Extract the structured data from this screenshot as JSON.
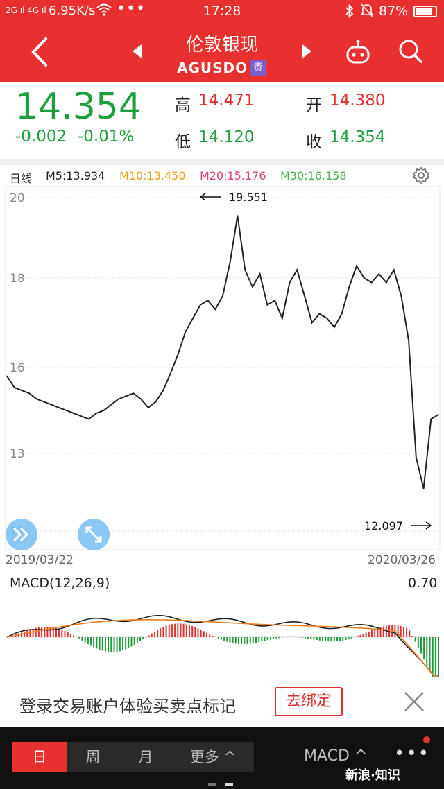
{
  "status_bar": {
    "signal": "2G ıl 4G ıl",
    "net_speed": "6.95K/s",
    "wifi_icon": "wifi-icon",
    "more_dots": "•••",
    "time": "17:28",
    "battery": "87%"
  },
  "header": {
    "title": "伦敦银现",
    "code": "AGUSDO",
    "badge": "贵"
  },
  "quote": {
    "price": "14.354",
    "change": "-0.002",
    "change_pct": "-0.01%",
    "high_label": "高",
    "high": "14.471",
    "open_label": "开",
    "open": "14.380",
    "low_label": "低",
    "low": "14.120",
    "close_label": "收",
    "close": "14.354"
  },
  "chart": {
    "period": "日线",
    "ma5": "M5:13.934",
    "ma10": "M10:13.450",
    "ma20": "M20:15.176",
    "ma30": "M30:16.158",
    "max_label": "19.551",
    "min_label": "12.097",
    "start_date": "2019/03/22",
    "end_date": "2020/03/26",
    "colors": {
      "ma5": "#222222",
      "ma10": "#e8a317",
      "ma20": "#e0407a",
      "ma30": "#4caf50",
      "up": "#e0302e",
      "down": "#1e9e3c"
    }
  },
  "chart_data": {
    "type": "line",
    "title": "",
    "xlabel": "",
    "ylabel": "",
    "ylim": [
      11,
      20
    ],
    "x_start": "2019/03/22",
    "x_end": "2020/03/26",
    "y_ticks": [
      20,
      18,
      16,
      13,
      11
    ],
    "series": [
      {
        "name": "",
        "values": [
          15.7,
          15.3,
          15.2,
          15.1,
          14.9,
          14.8,
          14.7,
          14.6,
          14.5,
          14.4,
          14.3,
          14.2,
          14.4,
          14.5,
          14.7,
          14.9,
          15.0,
          15.1,
          14.9,
          14.6,
          14.8,
          15.2,
          15.8,
          16.3,
          16.8,
          17.1,
          17.4,
          17.5,
          17.3,
          17.6,
          18.4,
          19.551,
          18.2,
          17.8,
          18.1,
          17.4,
          17.5,
          17.1,
          17.9,
          18.2,
          17.6,
          17.0,
          17.2,
          17.1,
          16.9,
          17.2,
          17.8,
          18.3,
          18.0,
          17.9,
          18.1,
          17.9,
          18.2,
          17.6,
          16.6,
          12.9,
          12.097,
          14.2,
          14.354
        ]
      }
    ]
  },
  "macd": {
    "label": "MACD(12,26,9)",
    "value": "0.70"
  },
  "promo": {
    "text": "登录交易账户体验买卖点标记",
    "button": "去绑定"
  },
  "bottom": {
    "tabs": [
      "日",
      "周",
      "月",
      "更多 ^"
    ],
    "indicator": "MACD ^",
    "more": "•••",
    "watermark": "新浪·知识"
  }
}
